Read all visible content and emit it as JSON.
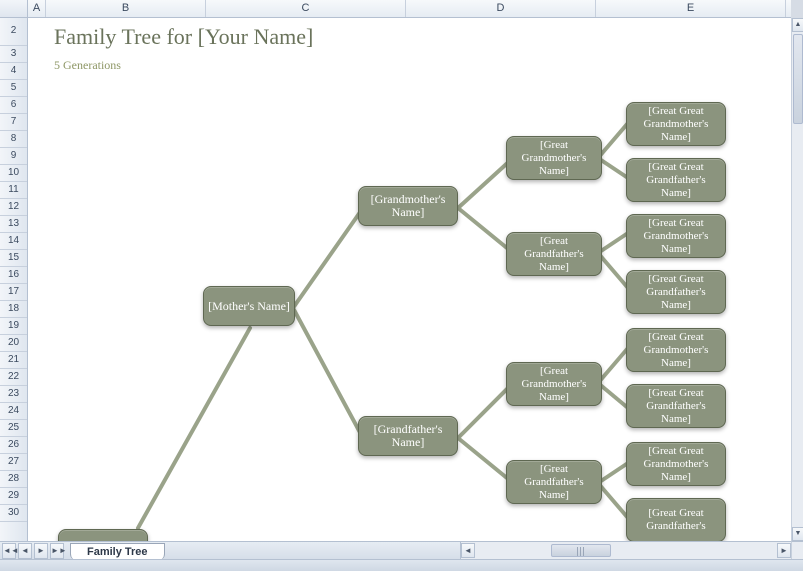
{
  "columns": {
    "A": "A",
    "B": "B",
    "C": "C",
    "D": "D",
    "E": "E"
  },
  "rows": [
    "2",
    "3",
    "4",
    "5",
    "6",
    "7",
    "8",
    "9",
    "10",
    "11",
    "12",
    "13",
    "14",
    "15",
    "16",
    "17",
    "18",
    "19",
    "20",
    "21",
    "22",
    "23",
    "24",
    "25",
    "26",
    "27",
    "28",
    "29",
    "30"
  ],
  "title": "Family Tree for [Your Name]",
  "subtitle": "5 Generations",
  "tab": "Family Tree",
  "nodes": {
    "mother": "[Mother's Name]",
    "grandmother": "[Grandmother's Name]",
    "grandfather": "[Grandfather's Name]",
    "greatGM1": "[Great Grandmother's Name]",
    "greatGF1": "[Great Grandfather's Name]",
    "greatGM2": "[Great Grandmother's Name]",
    "greatGF2": "[Great Grandfather's Name]",
    "gg1": "[Great Great Grandmother's Name]",
    "gg2": "[Great Great Grandfather's Name]",
    "gg3": "[Great Great Grandmother's Name]",
    "gg4": "[Great Great Grandfather's Name]",
    "gg5": "[Great Great Grandmother's Name]",
    "gg6": "[Great Great Grandfather's Name]",
    "gg7": "[Great Great Grandmother's Name]",
    "gg8": "[Great Great Grandfather's"
  }
}
